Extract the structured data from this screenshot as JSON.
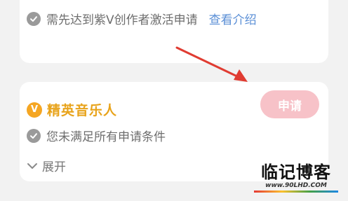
{
  "top_card": {
    "requirement_text": "需先达到紫V创作者激活申请",
    "link_label": "查看介绍",
    "check_icon": "check-circle-icon"
  },
  "music_card": {
    "badge_letter": "V",
    "badge_icon": "orange-v-badge-icon",
    "title": "精英音乐人",
    "apply_label": "申请",
    "status_text": "您未满足所有申请条件",
    "check_icon": "check-circle-icon",
    "expand_label": "展开",
    "expand_icon": "chevron-down-icon"
  },
  "annotation": {
    "arrow_icon": "red-arrow-icon"
  },
  "watermark": {
    "title": "临记博客",
    "url": "www.90LHD.COM"
  },
  "colors": {
    "background": "#f2f2f2",
    "card": "#ffffff",
    "link": "#5b8fd6",
    "title": "#e8a31a",
    "badge": "#f5a623",
    "apply_button": "#f7c2c8",
    "arrow": "#e03c32",
    "muted_icon": "#9a9a9a"
  }
}
